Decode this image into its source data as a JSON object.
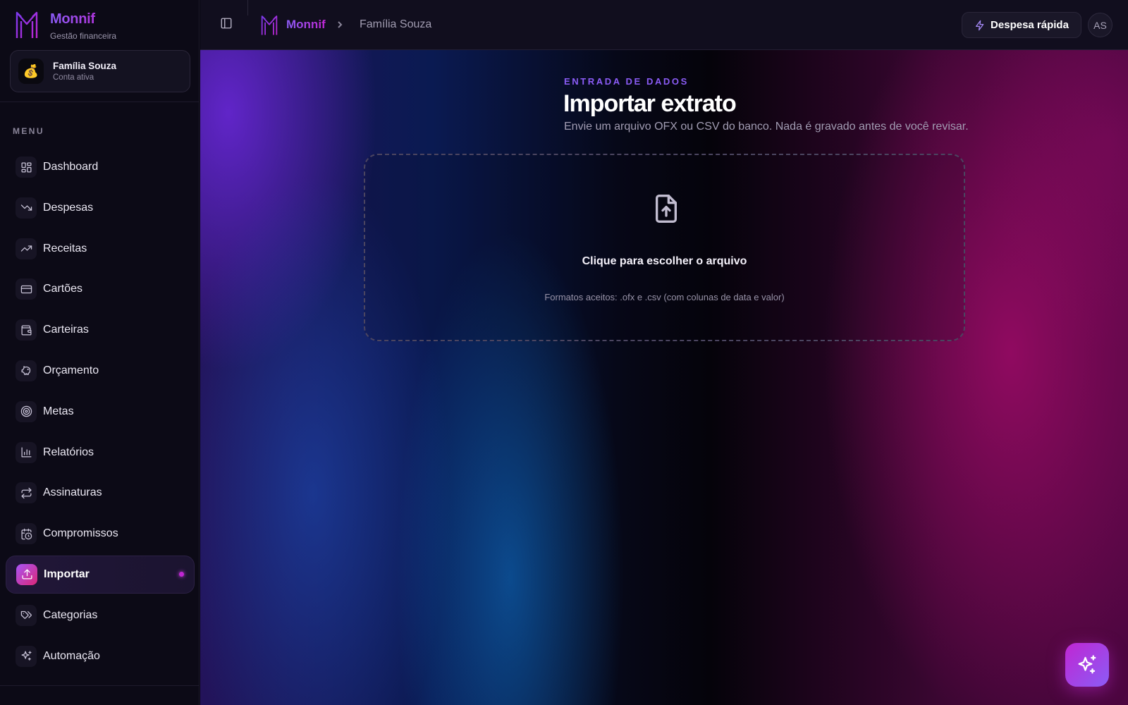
{
  "brand": {
    "name": "Monnif",
    "tagline": "Gestão financeira"
  },
  "account": {
    "emoji": "💰",
    "name": "Família Souza",
    "status": "Conta ativa"
  },
  "sidebar": {
    "menu_label": "MENU",
    "items": [
      {
        "label": "Dashboard",
        "icon": "dashboard-icon"
      },
      {
        "label": "Despesas",
        "icon": "trending-down-icon"
      },
      {
        "label": "Receitas",
        "icon": "trending-up-icon"
      },
      {
        "label": "Cartões",
        "icon": "credit-card-icon"
      },
      {
        "label": "Carteiras",
        "icon": "wallet-icon"
      },
      {
        "label": "Orçamento",
        "icon": "piggy-bank-icon"
      },
      {
        "label": "Metas",
        "icon": "target-icon"
      },
      {
        "label": "Relatórios",
        "icon": "bar-chart-icon"
      },
      {
        "label": "Assinaturas",
        "icon": "repeat-icon"
      },
      {
        "label": "Compromissos",
        "icon": "calendar-clock-icon"
      },
      {
        "label": "Importar",
        "icon": "upload-icon",
        "active": true
      },
      {
        "label": "Categorias",
        "icon": "tags-icon"
      },
      {
        "label": "Automação",
        "icon": "sparkles-icon"
      }
    ]
  },
  "header": {
    "breadcrumb_brand": "Monnif",
    "breadcrumb_current": "Família Souza",
    "quick_expense_label": "Despesa rápida",
    "user_initials": "AS"
  },
  "page": {
    "eyebrow": "ENTRADA DE DADOS",
    "title": "Importar extrato",
    "subtitle": "Envie um arquivo OFX ou CSV do banco. Nada é gravado antes de você revisar."
  },
  "dropzone": {
    "title": "Clique para escolher o arquivo",
    "hint": "Formatos aceitos: .ofx e .csv (com colunas de data e valor)"
  },
  "colors": {
    "accent_violet": "#8b5cf6",
    "accent_magenta": "#c026d3",
    "sidebar_bg": "#0c0a16"
  }
}
